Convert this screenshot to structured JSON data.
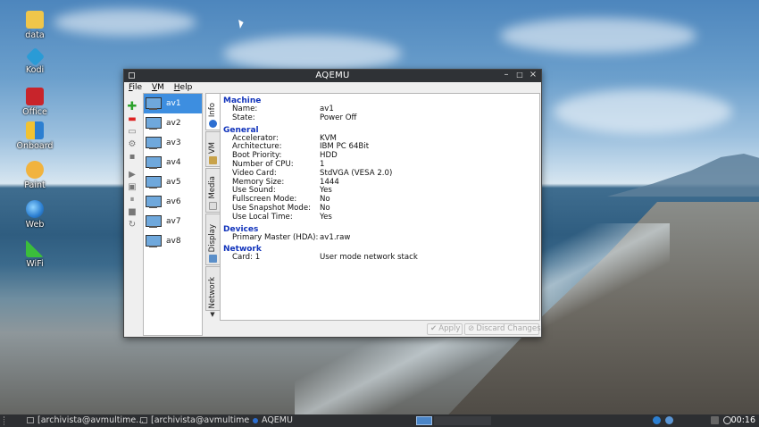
{
  "desktop": {
    "icons": [
      {
        "label": "data",
        "icon": "folder-icon",
        "color": "#f0c64a"
      },
      {
        "label": "Kodi",
        "icon": "kodi-icon",
        "color": "#2a9bd6"
      },
      {
        "label": "Office",
        "icon": "office-icon",
        "color": "#c8242b"
      },
      {
        "label": "Onboard",
        "icon": "keyboard-icon",
        "color": "#e8e8e8"
      },
      {
        "label": "Paint",
        "icon": "palette-icon",
        "color": "#f1b33e"
      },
      {
        "label": "Web",
        "icon": "globe-icon",
        "color": "#2c7fd1"
      },
      {
        "label": "WiFi",
        "icon": "wifi-icon",
        "color": "#3bbd3b"
      }
    ]
  },
  "window": {
    "title": "AQEMU",
    "menu": [
      "File",
      "VM",
      "Help"
    ],
    "vms": [
      "av1",
      "av2",
      "av3",
      "av4",
      "av5",
      "av6",
      "av7",
      "av8"
    ],
    "selected_vm": "av1",
    "tabs": [
      "Info",
      "VM",
      "Media",
      "Display",
      "Network"
    ],
    "active_tab": "Info",
    "info": {
      "machine": {
        "heading": "Machine",
        "rows": [
          [
            "Name:",
            "av1"
          ],
          [
            "State:",
            "Power Off"
          ]
        ]
      },
      "general": {
        "heading": "General",
        "rows": [
          [
            "Accelerator:",
            "KVM"
          ],
          [
            "Architecture:",
            "IBM PC 64Bit"
          ],
          [
            "Boot Priority:",
            "HDD"
          ],
          [
            "Number of CPU:",
            "1"
          ],
          [
            "Video Card:",
            "StdVGA (VESA 2.0)"
          ],
          [
            "Memory Size:",
            "1444"
          ],
          [
            "Use Sound:",
            "Yes"
          ],
          [
            "Fullscreen Mode:",
            "No"
          ],
          [
            "Use Snapshot Mode:",
            "No"
          ],
          [
            "Use Local Time:",
            "Yes"
          ]
        ]
      },
      "devices": {
        "heading": "Devices",
        "rows": [
          [
            "Primary Master (HDA):",
            "av1.raw"
          ]
        ]
      },
      "network": {
        "heading": "Network",
        "rows": [
          [
            "Card: 1",
            "User mode network stack"
          ]
        ]
      }
    },
    "buttons": {
      "apply": "Apply",
      "discard": "Discard Changes"
    }
  },
  "taskbar": {
    "tasks": [
      "[archivista@avmultime...",
      "[archivista@avmultime...",
      "AQEMU"
    ],
    "clock": "00:16"
  }
}
